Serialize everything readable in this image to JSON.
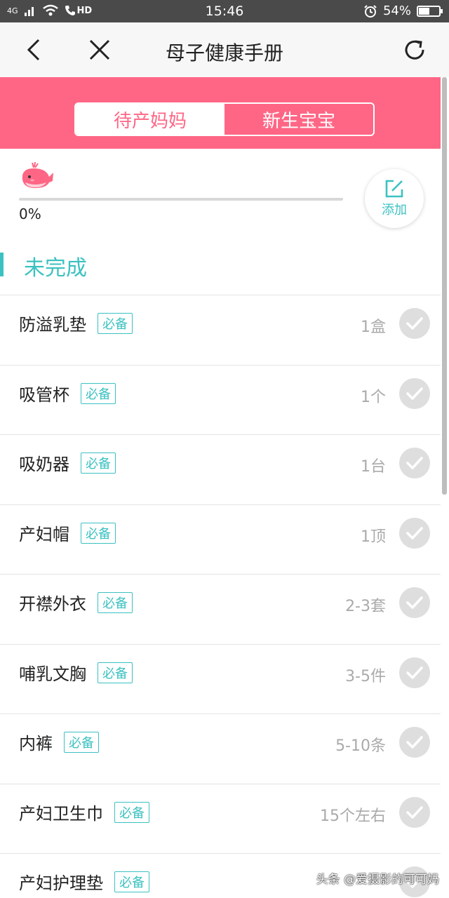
{
  "status_bar": {
    "network": "4G",
    "call_indicator": "HD",
    "time": "15:46",
    "battery_text": "54%",
    "battery_level": 0.54
  },
  "nav": {
    "title": "母子健康手册",
    "back_icon": "back-arrow-icon",
    "close_icon": "close-icon",
    "refresh_icon": "refresh-icon"
  },
  "segments": [
    {
      "label": "待产妈妈",
      "active": true
    },
    {
      "label": "新生宝宝",
      "active": false
    }
  ],
  "progress": {
    "value": 0,
    "text": "0%",
    "mascot_icon": "whale-icon"
  },
  "add_button": {
    "label": "添加",
    "icon": "edit-icon"
  },
  "section": {
    "title": "未完成"
  },
  "items": [
    {
      "name": "防溢乳垫",
      "tag": "必备",
      "qty": "1盒"
    },
    {
      "name": "吸管杯",
      "tag": "必备",
      "qty": "1个"
    },
    {
      "name": "吸奶器",
      "tag": "必备",
      "qty": "1台"
    },
    {
      "name": "产妇帽",
      "tag": "必备",
      "qty": "1顶"
    },
    {
      "name": "开襟外衣",
      "tag": "必备",
      "qty": "2-3套"
    },
    {
      "name": "哺乳文胸",
      "tag": "必备",
      "qty": "3-5件"
    },
    {
      "name": "内裤",
      "tag": "必备",
      "qty": "5-10条"
    },
    {
      "name": "产妇卫生巾",
      "tag": "必备",
      "qty": "15个左右"
    },
    {
      "name": "产妇护理垫",
      "tag": "必备",
      "qty": ""
    }
  ],
  "watermark": "头条 @爱摄影的可可妈",
  "colors": {
    "accent_pink": "#ff6685",
    "accent_teal": "#3cc1c1",
    "statusbar": "#4a4a4a"
  }
}
